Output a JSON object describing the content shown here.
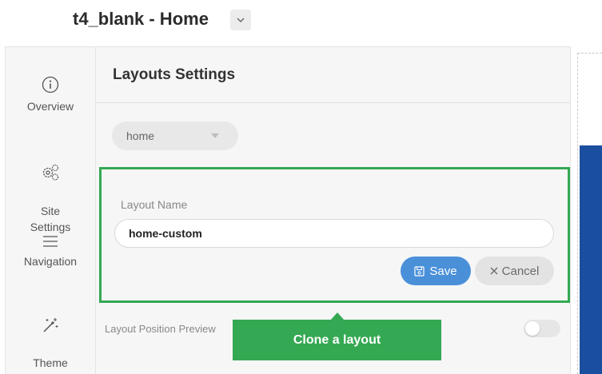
{
  "header": {
    "title": "t4_blank - Home"
  },
  "sidebar": {
    "items": [
      {
        "label": "Overview",
        "icon": "info-icon"
      },
      {
        "label": "Site\nSettings",
        "icon": "gears-icon"
      },
      {
        "label": "Navigation",
        "icon": "menu-icon"
      },
      {
        "label": "Theme\nSettings",
        "icon": "magic-wand-icon"
      }
    ]
  },
  "panel": {
    "title": "Layouts Settings",
    "layout_select": {
      "value": "home"
    },
    "clone_form": {
      "field_label": "Layout Name",
      "input_value": "home-custom",
      "save_label": "Save",
      "cancel_label": "Cancel"
    },
    "position_preview_label": "Layout Position Preview",
    "position_preview_enabled": false
  },
  "callout": {
    "text": "Clone a layout"
  },
  "colors": {
    "accent_green": "#35a853",
    "save_blue": "#4a90d9",
    "preview_blue": "#1a4fa0"
  }
}
